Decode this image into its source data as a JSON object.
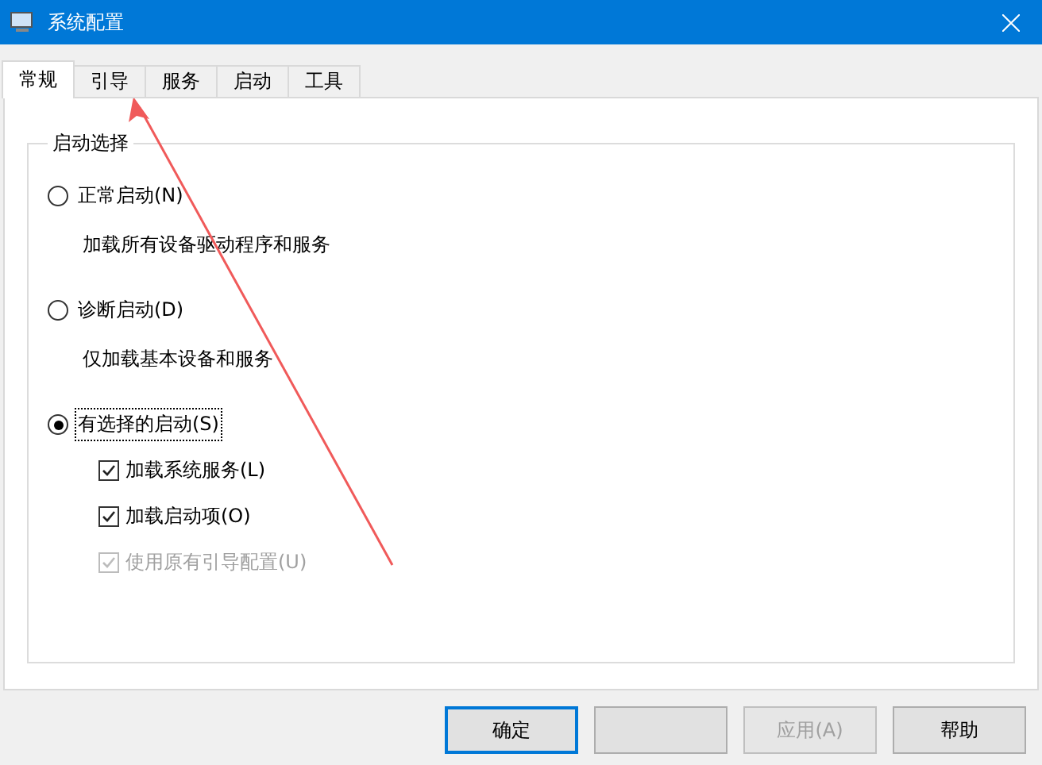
{
  "window": {
    "title": "系统配置"
  },
  "tabs": [
    {
      "label": "常规",
      "selected": true
    },
    {
      "label": "引导",
      "selected": false
    },
    {
      "label": "服务",
      "selected": false
    },
    {
      "label": "启动",
      "selected": false
    },
    {
      "label": "工具",
      "selected": false
    }
  ],
  "group": {
    "title": "启动选择",
    "options": [
      {
        "label": "正常启动(N)",
        "description": "加载所有设备驱动程序和服务",
        "selected": false,
        "focused": false
      },
      {
        "label": "诊断启动(D)",
        "description": "仅加载基本设备和服务",
        "selected": false,
        "focused": false
      },
      {
        "label": "有选择的启动(S)",
        "selected": true,
        "focused": true,
        "checkboxes": [
          {
            "label": "加载系统服务(L)",
            "checked": true,
            "disabled": false
          },
          {
            "label": "加载启动项(O)",
            "checked": true,
            "disabled": false
          },
          {
            "label": "使用原有引导配置(U)",
            "checked": true,
            "disabled": true
          }
        ]
      }
    ]
  },
  "buttons": [
    {
      "label": "确定",
      "default": true,
      "disabled": false
    },
    {
      "default": false,
      "disabled": false
    },
    {
      "label": "应用(A)",
      "default": false,
      "disabled": true
    },
    {
      "label": "帮助",
      "default": false,
      "disabled": false
    }
  ],
  "annotation": {
    "kind": "arrow"
  }
}
